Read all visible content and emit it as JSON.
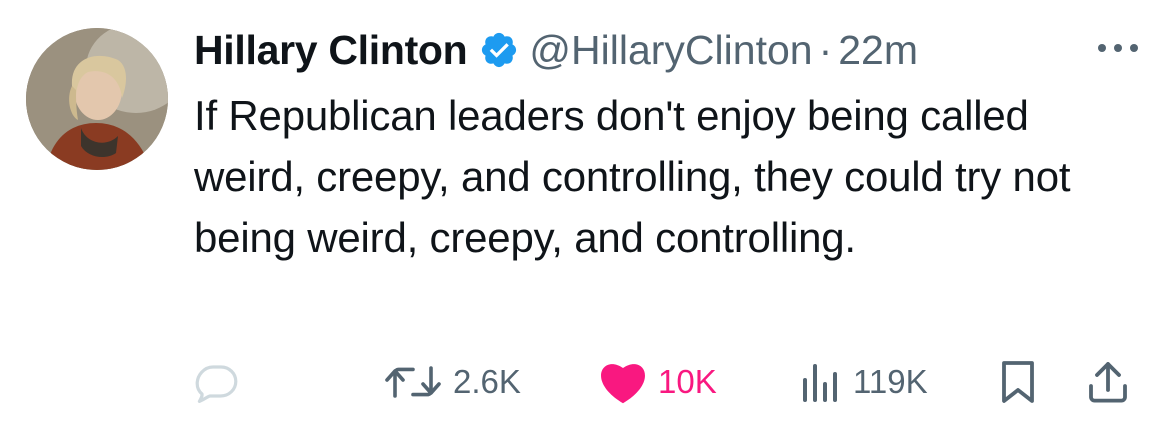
{
  "author": {
    "name": "Hillary Clinton",
    "handle": "@HillaryClinton",
    "separator": "·",
    "time": "22m",
    "verified": true,
    "verified_color": "#1d9bf0"
  },
  "tweet": {
    "text": "If Republican leaders don't enjoy being called weird, creepy, and controlling, they could try not being weird, creepy, and controlling."
  },
  "actions": {
    "reply": {
      "icon": "reply-icon",
      "count": ""
    },
    "retweet": {
      "icon": "retweet-icon",
      "count": "2.6K"
    },
    "like": {
      "icon": "heart-icon",
      "count": "10K",
      "liked": true,
      "color": "#f91880"
    },
    "views": {
      "icon": "views-icon",
      "count": "119K"
    },
    "bookmark": {
      "icon": "bookmark-icon"
    },
    "share": {
      "icon": "share-icon"
    }
  },
  "colors": {
    "text": "#0f1419",
    "secondary": "#536471",
    "accent": "#1d9bf0",
    "like": "#f91880"
  }
}
